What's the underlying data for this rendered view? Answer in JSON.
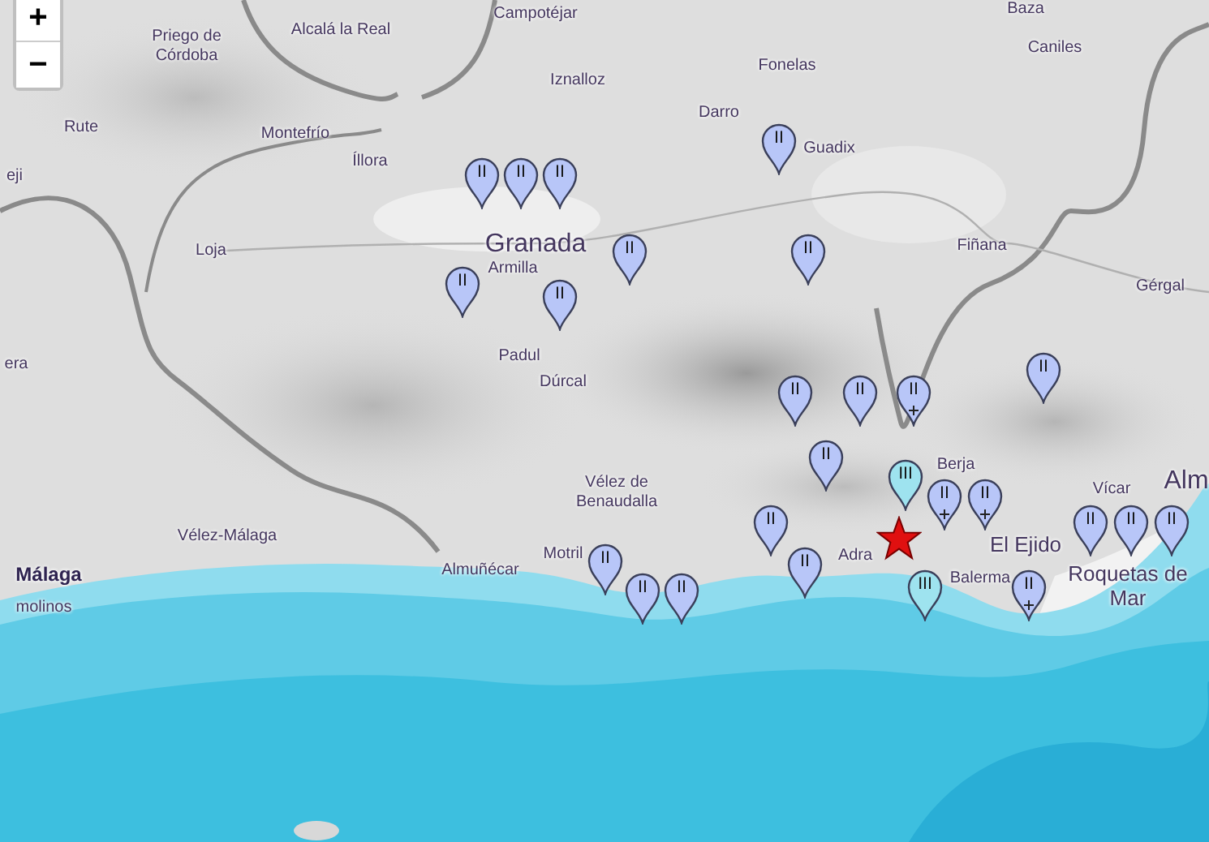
{
  "zoom_controls": [
    {
      "label": "+"
    },
    {
      "label": "−"
    }
  ],
  "place_labels": [
    {
      "lines": [
        "Priego de",
        "Córdoba"
      ],
      "kind": "town"
    },
    {
      "lines": [
        "Alcalá la Real"
      ],
      "kind": "town"
    },
    {
      "lines": [
        "Campotéjar"
      ],
      "kind": "town"
    },
    {
      "lines": [
        "Iznalloz"
      ],
      "kind": "town"
    },
    {
      "lines": [
        "Fonelas"
      ],
      "kind": "town"
    },
    {
      "lines": [
        "Darro"
      ],
      "kind": "town"
    },
    {
      "lines": [
        "Guadix"
      ],
      "kind": "town"
    },
    {
      "lines": [
        "Baza"
      ],
      "kind": "town"
    },
    {
      "lines": [
        "Caniles"
      ],
      "kind": "town"
    },
    {
      "lines": [
        "Rute"
      ],
      "kind": "town"
    },
    {
      "lines": [
        "Montefrío"
      ],
      "kind": "town"
    },
    {
      "lines": [
        "Íllora"
      ],
      "kind": "town"
    },
    {
      "lines": [
        "eji"
      ],
      "kind": "town"
    },
    {
      "lines": [
        "Loja"
      ],
      "kind": "town"
    },
    {
      "lines": [
        "Granada"
      ],
      "kind": "capital"
    },
    {
      "lines": [
        "Armilla"
      ],
      "kind": "town"
    },
    {
      "lines": [
        "Fiñana"
      ],
      "kind": "town"
    },
    {
      "lines": [
        "Gérgal"
      ],
      "kind": "town"
    },
    {
      "lines": [
        "era"
      ],
      "kind": "town"
    },
    {
      "lines": [
        "Padul"
      ],
      "kind": "town"
    },
    {
      "lines": [
        "Dúrcal"
      ],
      "kind": "town"
    },
    {
      "lines": [
        "Vélez de",
        "Benaudalla"
      ],
      "kind": "town"
    },
    {
      "lines": [
        "Vélez-Málaga"
      ],
      "kind": "town"
    },
    {
      "lines": [
        "Málaga"
      ],
      "kind": "city"
    },
    {
      "lines": [
        "Almuñécar"
      ],
      "kind": "town"
    },
    {
      "lines": [
        "Motril"
      ],
      "kind": "town"
    },
    {
      "lines": [
        "molinos"
      ],
      "kind": "town"
    },
    {
      "lines": [
        "Adra"
      ],
      "kind": "town"
    },
    {
      "lines": [
        "Berja"
      ],
      "kind": "town"
    },
    {
      "lines": [
        "El Ejido"
      ],
      "kind": "large"
    },
    {
      "lines": [
        "Balerma"
      ],
      "kind": "town"
    },
    {
      "lines": [
        "Vícar"
      ],
      "kind": "town"
    },
    {
      "lines": [
        "Roquetas de",
        "Mar"
      ],
      "kind": "large"
    },
    {
      "lines": [
        "Alm"
      ],
      "kind": "capital"
    }
  ],
  "markers": [
    {
      "intensity": "II",
      "color": "#b8c6f8",
      "cross": false
    },
    {
      "intensity": "II",
      "color": "#b8c6f8",
      "cross": false
    },
    {
      "intensity": "II",
      "color": "#b8c6f8",
      "cross": false
    },
    {
      "intensity": "II",
      "color": "#b8c6f8",
      "cross": false
    },
    {
      "intensity": "II",
      "color": "#b8c6f8",
      "cross": false
    },
    {
      "intensity": "II",
      "color": "#b8c6f8",
      "cross": false
    },
    {
      "intensity": "II",
      "color": "#b8c6f8",
      "cross": false
    },
    {
      "intensity": "II",
      "color": "#b8c6f8",
      "cross": false
    },
    {
      "intensity": "II",
      "color": "#b8c6f8",
      "cross": false
    },
    {
      "intensity": "II",
      "color": "#b8c6f8",
      "cross": false
    },
    {
      "intensity": "II",
      "color": "#b8c6f8",
      "cross": false
    },
    {
      "intensity": "II",
      "color": "#b8c6f8",
      "cross": true
    },
    {
      "intensity": "II",
      "color": "#b8c6f8",
      "cross": false
    },
    {
      "intensity": "III",
      "color": "#9ee3ef",
      "cross": false
    },
    {
      "intensity": "II",
      "color": "#b8c6f8",
      "cross": true
    },
    {
      "intensity": "II",
      "color": "#b8c6f8",
      "cross": true
    },
    {
      "intensity": "II",
      "color": "#b8c6f8",
      "cross": false
    },
    {
      "intensity": "II",
      "color": "#b8c6f8",
      "cross": false
    },
    {
      "intensity": "II",
      "color": "#b8c6f8",
      "cross": false
    },
    {
      "intensity": "II",
      "color": "#b8c6f8",
      "cross": false
    },
    {
      "intensity": "II",
      "color": "#b8c6f8",
      "cross": false
    },
    {
      "intensity": "II",
      "color": "#b8c6f8",
      "cross": false
    },
    {
      "intensity": "II",
      "color": "#b8c6f8",
      "cross": false
    },
    {
      "intensity": "II",
      "color": "#b8c6f8",
      "cross": false
    },
    {
      "intensity": "III",
      "color": "#9ee3ef",
      "cross": false
    },
    {
      "intensity": "II",
      "color": "#b8c6f8",
      "cross": true
    }
  ]
}
